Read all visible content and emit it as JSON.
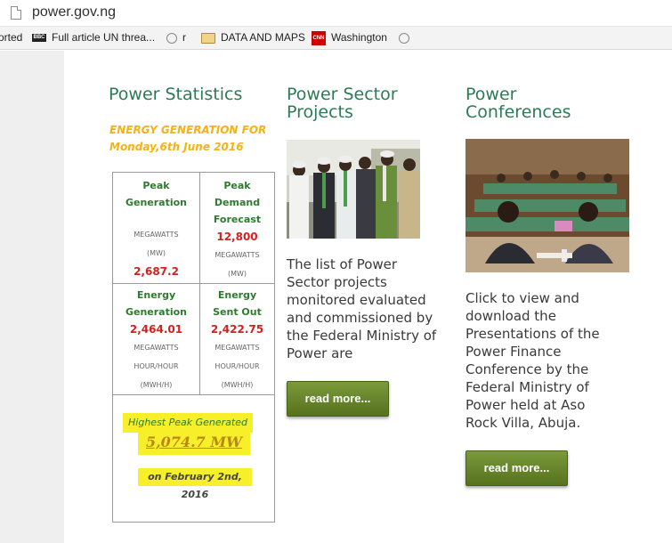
{
  "browser": {
    "url": "power.gov.ng",
    "bookmarks": [
      {
        "label": "orted"
      },
      {
        "label": "Full article UN threa..."
      },
      {
        "label": "r"
      },
      {
        "label": "DATA AND MAPS"
      },
      {
        "label": "Washington"
      }
    ],
    "bbc_icon": "BBC",
    "cnn_icon": "CNN"
  },
  "power_statistics": {
    "title": "Power Statistics",
    "subtitle_line1": "ENERGY GENERATION FOR",
    "subtitle_line2": "Monday,6th June 2016",
    "cells": [
      {
        "label_l1": "Peak",
        "label_l2": "Generation",
        "label_l3": "",
        "unit_l1": "MEGAWATTS",
        "unit_l2": "(MW)",
        "value": "2,687.2"
      },
      {
        "label_l1": "Peak",
        "label_l2": "Demand",
        "label_l3": "Forecast",
        "value": "12,800",
        "unit_l1": "MEGAWATTS",
        "unit_l2": "(MW)"
      },
      {
        "label_l1": "Energy",
        "label_l2": "Generation",
        "value": "2,464.01",
        "unit_l1": "MEGAWATTS",
        "unit_l2": "HOUR/HOUR",
        "unit_l3": "(MWH/H)"
      },
      {
        "label_l1": "Energy",
        "label_l2": "Sent Out",
        "value": "2,422.75",
        "unit_l1": "MEGAWATTS",
        "unit_l2": "HOUR/HOUR",
        "unit_l3": "(MWH/H)"
      }
    ],
    "highest_label": "Highest Peak Generated",
    "highest_dash": "-",
    "highest_value": "5,074.7 MW",
    "highest_date": "on February 2nd, 2016"
  },
  "power_sector_projects": {
    "title_l1": "Power Sector",
    "title_l2": "Projects",
    "desc": [
      "The list of Power",
      "Sector projects",
      "monitored evaluated",
      "and commissioned by",
      "the Federal Ministry of",
      "Power are"
    ],
    "button": "read more..."
  },
  "power_conferences": {
    "title_l1": "Power",
    "title_l2": "Conferences",
    "desc": [
      "Click to view and",
      "download the",
      "Presentations of the",
      "Power Finance",
      "Conference by the",
      "Federal Ministry of",
      "Power held at Aso",
      "Rock Villa, Abuja."
    ],
    "button": "read more..."
  }
}
